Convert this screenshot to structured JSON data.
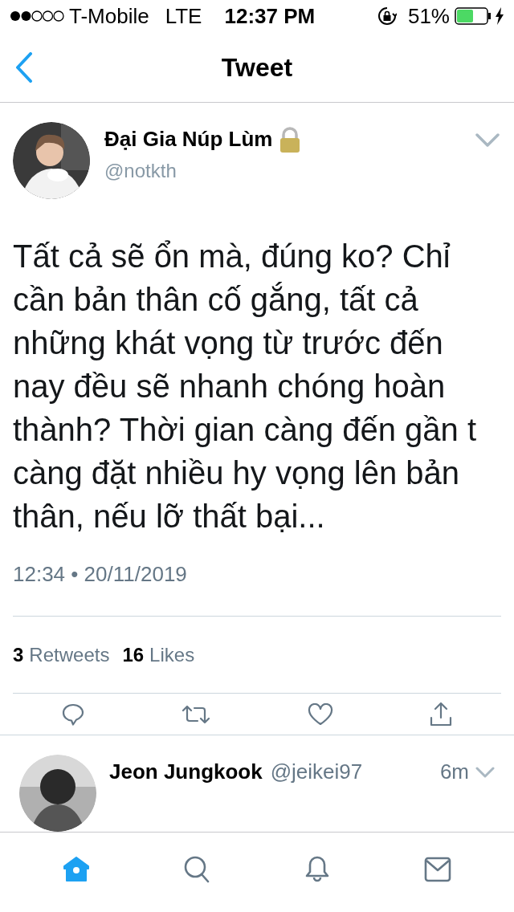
{
  "status_bar": {
    "carrier": "T-Mobile",
    "network": "LTE",
    "time": "12:37 PM",
    "battery": "51%",
    "charging": true
  },
  "nav": {
    "title": "Tweet"
  },
  "tweet": {
    "name": "Đại Gia Núp Lùm",
    "protected": true,
    "handle": "@notkth",
    "text": "Tất cả sẽ ổn mà, đúng ko? Chỉ cần bản thân cố gắng, tất cả những khát vọng từ trước đến nay đều sẽ nhanh chóng hoàn thành? Thời gian càng đến gần t càng đặt nhiều hy vọng lên bản thân, nếu lỡ thất bại...",
    "timestamp": "12:34 • 20/11/2019",
    "retweets": "3",
    "retweets_label": "Retweets",
    "likes": "16",
    "likes_label": "Likes"
  },
  "reply": {
    "name": "Jeon Jungkook",
    "handle": "@jeikei97",
    "age": "6m"
  },
  "tab_bar": [
    {
      "kind": "home",
      "selected": true
    },
    {
      "kind": "search",
      "selected": false
    },
    {
      "kind": "bell",
      "selected": false
    },
    {
      "kind": "mail",
      "selected": false
    }
  ]
}
